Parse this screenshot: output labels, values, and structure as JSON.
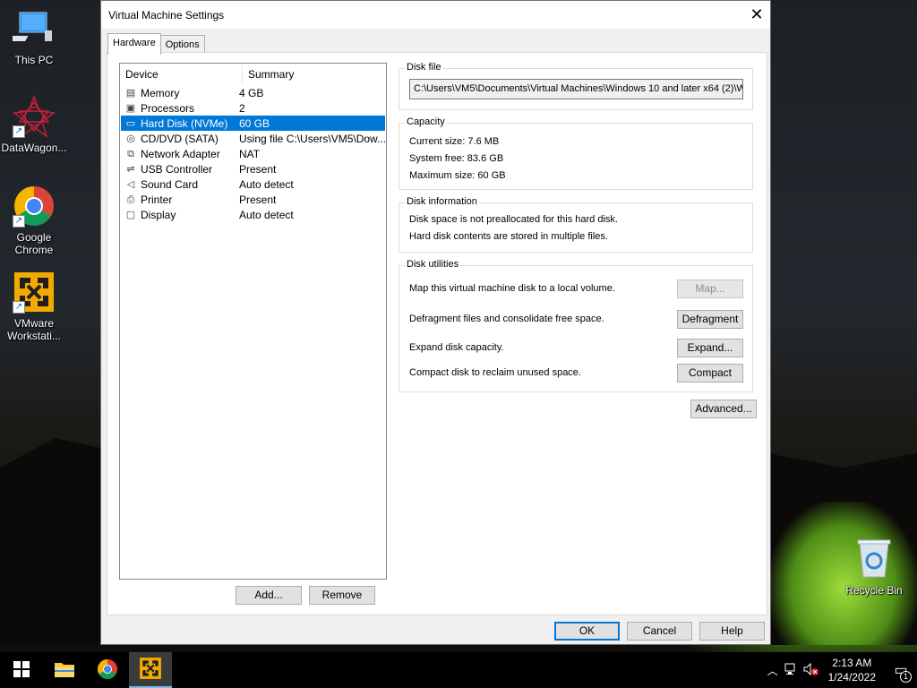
{
  "desktop": {
    "icons": [
      {
        "label": "This PC",
        "icon": "computer-icon"
      },
      {
        "label": "DataWagon...",
        "icon": "datawagon-icon"
      },
      {
        "label": "Google Chrome",
        "icon": "chrome-icon"
      },
      {
        "label": "VMware Workstati...",
        "icon": "vmware-icon"
      }
    ],
    "recycle_bin": {
      "label": "Recycle Bin",
      "icon": "recycle-bin-icon"
    }
  },
  "window": {
    "title": "Virtual Machine Settings",
    "tabs": [
      {
        "label": "Hardware",
        "active": true
      },
      {
        "label": "Options",
        "active": false
      }
    ],
    "device_list": {
      "headers": [
        "Device",
        "Summary"
      ],
      "rows": [
        {
          "device": "Memory",
          "summary": "4 GB",
          "icon": "memory-icon"
        },
        {
          "device": "Processors",
          "summary": "2",
          "icon": "processor-icon"
        },
        {
          "device": "Hard Disk (NVMe)",
          "summary": "60 GB",
          "icon": "hard-disk-icon",
          "selected": true
        },
        {
          "device": "CD/DVD (SATA)",
          "summary": "Using file C:\\Users\\VM5\\Dow...",
          "icon": "cd-dvd-icon"
        },
        {
          "device": "Network Adapter",
          "summary": "NAT",
          "icon": "network-icon"
        },
        {
          "device": "USB Controller",
          "summary": "Present",
          "icon": "usb-icon"
        },
        {
          "device": "Sound Card",
          "summary": "Auto detect",
          "icon": "sound-icon"
        },
        {
          "device": "Printer",
          "summary": "Present",
          "icon": "printer-icon"
        },
        {
          "device": "Display",
          "summary": "Auto detect",
          "icon": "display-icon"
        }
      ]
    },
    "add_button": "Add...",
    "remove_button": "Remove",
    "disk_file": {
      "title": "Disk file",
      "value": "C:\\Users\\VM5\\Documents\\Virtual Machines\\Windows 10 and later x64 (2)\\W"
    },
    "capacity": {
      "title": "Capacity",
      "current_size": "Current size:  7.6 MB",
      "system_free": "System free:  83.6 GB",
      "maximum_size": "Maximum size:  60 GB"
    },
    "disk_information": {
      "title": "Disk information",
      "line1": "Disk space is not preallocated for this hard disk.",
      "line2": "Hard disk contents are stored in multiple files."
    },
    "disk_utilities": {
      "title": "Disk utilities",
      "map_text": "Map this virtual machine disk to a local volume.",
      "map_button": "Map...",
      "defrag_text": "Defragment files and consolidate free space.",
      "defrag_button": "Defragment",
      "expand_text": "Expand disk capacity.",
      "expand_button": "Expand...",
      "compact_text": "Compact disk to reclaim unused space.",
      "compact_button": "Compact"
    },
    "advanced_button": "Advanced...",
    "ok_button": "OK",
    "cancel_button": "Cancel",
    "help_button": "Help"
  },
  "taskbar": {
    "time": "2:13 AM",
    "date": "1/24/2022",
    "notification_count": "1",
    "items": [
      "start-icon",
      "file-explorer-icon",
      "chrome-icon",
      "vmware-icon"
    ]
  }
}
